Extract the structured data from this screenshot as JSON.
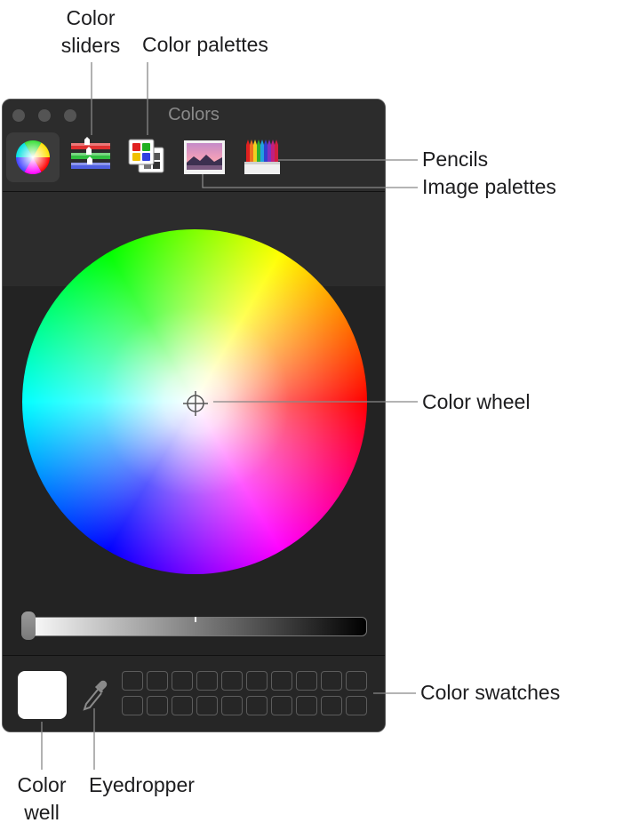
{
  "callouts": {
    "color_sliders": [
      "Color",
      "sliders"
    ],
    "color_palettes": "Color palettes",
    "pencils": "Pencils",
    "image_palettes": "Image palettes",
    "color_wheel": "Color wheel",
    "color_swatches": "Color swatches",
    "color_well": [
      "Color",
      "well"
    ],
    "eyedropper": "Eyedropper"
  },
  "window": {
    "title": "Colors",
    "toolbar": [
      "color-wheel-icon",
      "color-sliders-icon",
      "color-palettes-icon",
      "image-palettes-icon",
      "pencils-icon"
    ],
    "selected_tool": "color-wheel-icon",
    "brightness": 1.0,
    "color_well_value": "#ffffff",
    "swatch_rows": 2,
    "swatch_cols": 10
  }
}
